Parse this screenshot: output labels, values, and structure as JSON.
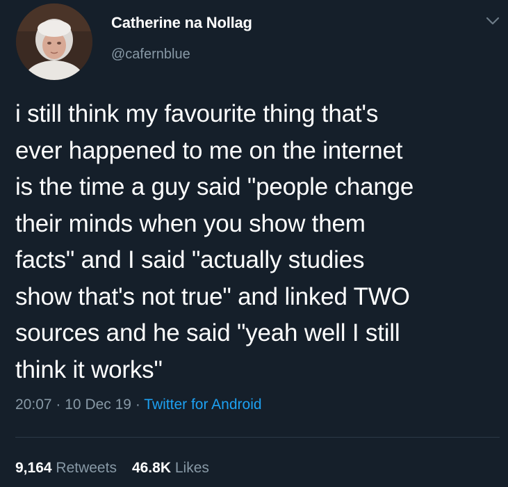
{
  "author": {
    "display_name": "Catherine na Nollag",
    "handle": "@cafernblue",
    "avatar_icon": "avatar-photo"
  },
  "tweet": {
    "lines": [
      "i still think my favourite thing that's",
      "ever happened to me on the internet",
      "is the time a guy said \"people change",
      "their minds when you show them",
      "facts\" and I said \"actually studies",
      "show that's not true\" and linked TWO",
      "sources and he said \"yeah well I still",
      "think it works\""
    ]
  },
  "meta": {
    "time": "20:07",
    "date": "10 Dec 19",
    "separator": "·",
    "source": "Twitter for Android"
  },
  "stats": {
    "retweets_count": "9,164",
    "retweets_label": "Retweets",
    "likes_count": "46.8K",
    "likes_label": "Likes"
  },
  "colors": {
    "background": "#151f2a",
    "secondary_text": "#8899a6",
    "link": "#1da1f2"
  },
  "icons": {
    "menu": "chevron-down-icon"
  }
}
